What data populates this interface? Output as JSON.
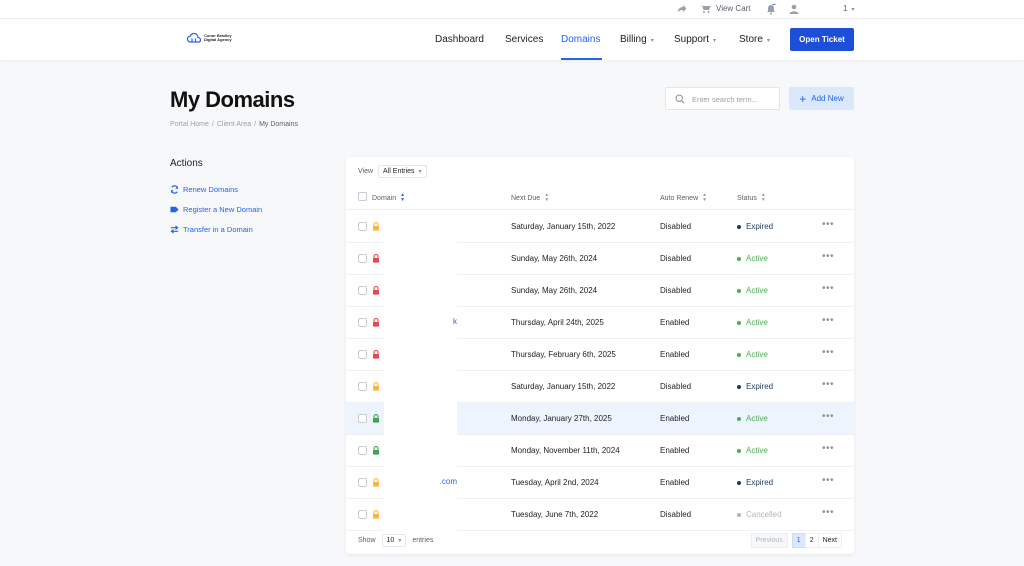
{
  "topbar": {
    "view_cart": "View Cart",
    "account": "1"
  },
  "nav": {
    "logo_text": "Conor Bradley Digital Agency",
    "items": [
      {
        "label": "Dashboard"
      },
      {
        "label": "Services"
      },
      {
        "label": "Domains"
      },
      {
        "label": "Billing"
      },
      {
        "label": "Support"
      },
      {
        "label": "Store"
      }
    ],
    "open_ticket": "Open Ticket"
  },
  "page": {
    "title": "My Domains",
    "breadcrumb": [
      "Portal Home",
      "Client Area",
      "My Domains"
    ],
    "search_placeholder": "Enter search term...",
    "add_new": "Add New"
  },
  "sidebar": {
    "title": "Actions",
    "items": [
      {
        "label": "Renew Domains",
        "icon": "refresh-icon"
      },
      {
        "label": "Register a New Domain",
        "icon": "tag-icon"
      },
      {
        "label": "Transfer in a Domain",
        "icon": "transfer-icon"
      }
    ]
  },
  "table": {
    "view_label": "View",
    "view_value": "All Entries",
    "columns": {
      "domain": "Domain",
      "next_due": "Next Due",
      "auto_renew": "Auto Renew",
      "status": "Status"
    },
    "rows": [
      {
        "domain": "",
        "next_due": "Saturday, January 15th, 2022",
        "auto_renew": "Disabled",
        "status": "Expired",
        "lock_color": "#f5b83d"
      },
      {
        "domain": "",
        "next_due": "Sunday, May 26th, 2024",
        "auto_renew": "Disabled",
        "status": "Active",
        "lock_color": "#e5484d"
      },
      {
        "domain": "",
        "next_due": "Sunday, May 26th, 2024",
        "auto_renew": "Disabled",
        "status": "Active",
        "lock_color": "#e5484d"
      },
      {
        "domain": "k",
        "next_due": "Thursday, April 24th, 2025",
        "auto_renew": "Enabled",
        "status": "Active",
        "lock_color": "#e5484d"
      },
      {
        "domain": "",
        "next_due": "Thursday, February 6th, 2025",
        "auto_renew": "Enabled",
        "status": "Active",
        "lock_color": "#e5484d"
      },
      {
        "domain": "",
        "next_due": "Saturday, January 15th, 2022",
        "auto_renew": "Disabled",
        "status": "Expired",
        "lock_color": "#f5b83d"
      },
      {
        "domain": "",
        "next_due": "Monday, January 27th, 2025",
        "auto_renew": "Enabled",
        "status": "Active",
        "lock_color": "#3fa34d"
      },
      {
        "domain": "",
        "next_due": "Monday, November 11th, 2024",
        "auto_renew": "Enabled",
        "status": "Active",
        "lock_color": "#3fa34d"
      },
      {
        "domain": ".com",
        "next_due": "Tuesday, April 2nd, 2024",
        "auto_renew": "Enabled",
        "status": "Expired",
        "lock_color": "#f5b83d"
      },
      {
        "domain": "",
        "next_due": "Tuesday, June 7th, 2022",
        "auto_renew": "Disabled",
        "status": "Cancelled",
        "lock_color": "#f5b83d"
      }
    ],
    "status_colors": {
      "Expired": "#1e3a5f",
      "Active": "#4caf50",
      "Cancelled": "#b0b5bd"
    },
    "footer": {
      "show_label": "Show",
      "show_value": "10",
      "entries_label": "entries",
      "pager": [
        "Previous",
        "1",
        "2",
        "Next"
      ],
      "current_page": "1"
    }
  }
}
